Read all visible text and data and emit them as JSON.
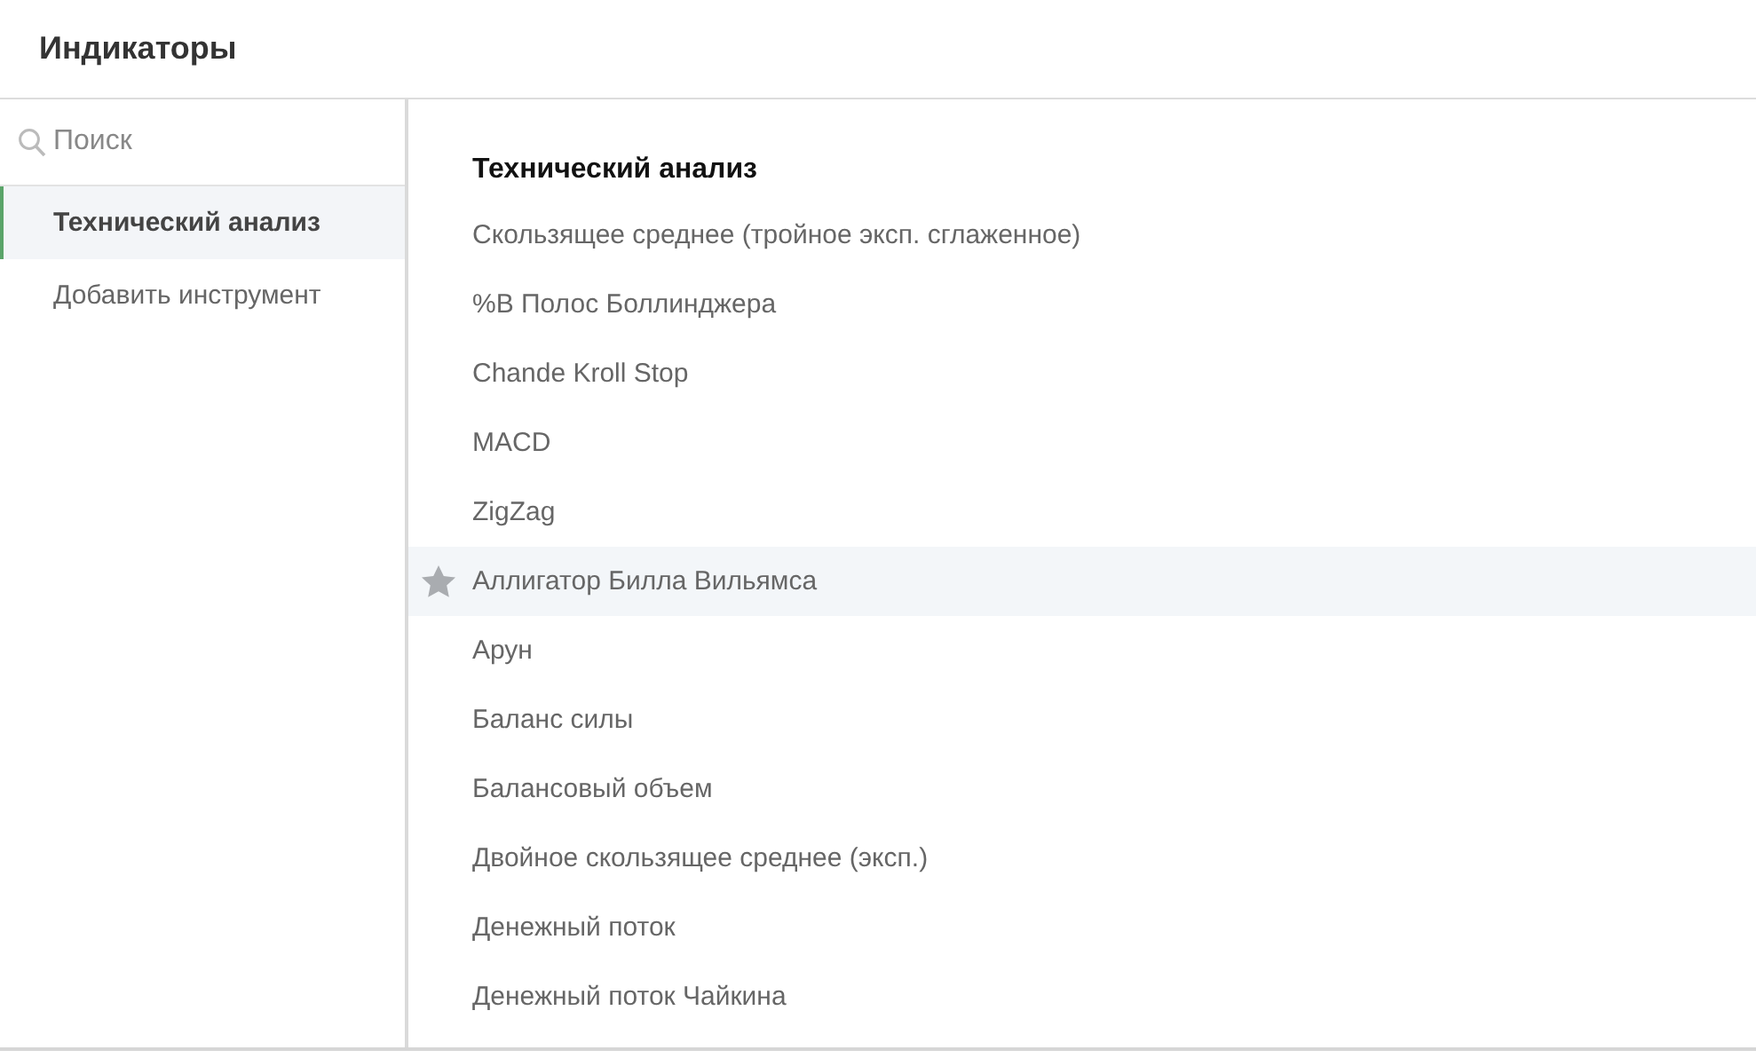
{
  "window": {
    "title": "Индикаторы"
  },
  "search": {
    "placeholder": "Поиск"
  },
  "sidebar": {
    "items": [
      {
        "label": "Технический анализ",
        "selected": true
      },
      {
        "label": "Добавить инструмент",
        "selected": false
      }
    ]
  },
  "list": {
    "heading": "Технический анализ",
    "items": [
      {
        "label": "Скользящее среднее (тройное эксп. сглаженное)",
        "highlighted": false
      },
      {
        "label": "%B Полос Боллинджера",
        "highlighted": false
      },
      {
        "label": "Chande Kroll Stop",
        "highlighted": false
      },
      {
        "label": "MACD",
        "highlighted": false
      },
      {
        "label": "ZigZag",
        "highlighted": false
      },
      {
        "label": "Аллигатор Билла Вильямса",
        "highlighted": true
      },
      {
        "label": "Арун",
        "highlighted": false
      },
      {
        "label": "Баланс силы",
        "highlighted": false
      },
      {
        "label": "Балансовый объем",
        "highlighted": false
      },
      {
        "label": "Двойное скользящее среднее (эксп.)",
        "highlighted": false
      },
      {
        "label": "Денежный поток",
        "highlighted": false
      },
      {
        "label": "Денежный поток Чайкина",
        "highlighted": false
      }
    ]
  }
}
